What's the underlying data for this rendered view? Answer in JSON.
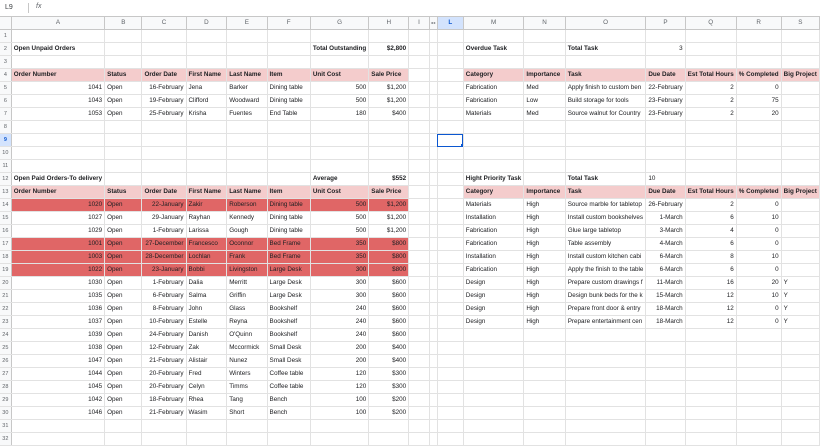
{
  "formula_bar": {
    "cell_ref": "L9",
    "fx": "fx"
  },
  "grid": {
    "columns": [
      "A",
      "B",
      "C",
      "D",
      "E",
      "F",
      "G",
      "H",
      "I",
      "◂ ▸",
      "L",
      "M",
      "N",
      "O",
      "P",
      "Q",
      "R",
      "S"
    ],
    "row_numbers": [
      "1",
      "2",
      "3",
      "4",
      "5",
      "6",
      "7",
      "8",
      "9",
      "10",
      "11",
      "12",
      "13",
      "14",
      "15",
      "16",
      "17",
      "18",
      "19",
      "20",
      "21",
      "22",
      "23",
      "24",
      "25",
      "26",
      "27",
      "28",
      "29",
      "30",
      "31",
      "32"
    ],
    "selected_cell": "L9",
    "colors": {
      "header_pink": "#f4cccc",
      "highlight_red": "#e06666",
      "selection_blue": "#0b57d0"
    }
  },
  "left": {
    "unpaid_title": "Open Unpaid Orders",
    "total_outstanding_label": "Total Outstanding",
    "total_outstanding_value": "$2,800",
    "headers": [
      "Order Number",
      "Status",
      "Order Date",
      "First Name",
      "Last Name",
      "Item",
      "Unit Cost",
      "Sale Price"
    ],
    "unpaid_rows": [
      [
        "1041",
        "Open",
        "16-February",
        "Jena",
        "Barker",
        "Dining table",
        "500",
        "$1,200"
      ],
      [
        "1043",
        "Open",
        "19-February",
        "Clifford",
        "Woodward",
        "Dining table",
        "500",
        "$1,200"
      ],
      [
        "1053",
        "Open",
        "25-February",
        "Krisha",
        "Fuentes",
        "End Table",
        "180",
        "$400"
      ]
    ],
    "paid_title": "Open Paid Orders-To delivery",
    "average_label": "Average",
    "average_value": "$552",
    "paid_rows": [
      [
        "1020",
        "Open",
        "22-January",
        "Zakir",
        "Roberson",
        "Dining table",
        "500",
        "$1,200"
      ],
      [
        "1027",
        "Open",
        "29-January",
        "Rayhan",
        "Kennedy",
        "Dining table",
        "500",
        "$1,200"
      ],
      [
        "1029",
        "Open",
        "1-February",
        "Larissa",
        "Gough",
        "Dining table",
        "500",
        "$1,200"
      ],
      [
        "1001",
        "Open",
        "27-December",
        "Francesco",
        "Oconnor",
        "Bed Frame",
        "350",
        "$800"
      ],
      [
        "1003",
        "Open",
        "28-December",
        "Lochlan",
        "Frank",
        "Bed Frame",
        "350",
        "$800"
      ],
      [
        "1022",
        "Open",
        "23-January",
        "Bobbi",
        "Livingston",
        "Large Desk",
        "300",
        "$800"
      ],
      [
        "1030",
        "Open",
        "1-February",
        "Dalia",
        "Merritt",
        "Large Desk",
        "300",
        "$600"
      ],
      [
        "1035",
        "Open",
        "6-February",
        "Salma",
        "Griffin",
        "Large Desk",
        "300",
        "$600"
      ],
      [
        "1036",
        "Open",
        "8-February",
        "John",
        "Glass",
        "Bookshelf",
        "240",
        "$600"
      ],
      [
        "1037",
        "Open",
        "10-February",
        "Estelle",
        "Reyna",
        "Bookshelf",
        "240",
        "$600"
      ],
      [
        "1039",
        "Open",
        "24-February",
        "Danish",
        "O'Quinn",
        "Bookshelf",
        "240",
        "$600"
      ],
      [
        "1038",
        "Open",
        "12-February",
        "Zak",
        "Mccormick",
        "Small Desk",
        "200",
        "$400"
      ],
      [
        "1047",
        "Open",
        "21-February",
        "Alistair",
        "Nunez",
        "Small Desk",
        "200",
        "$400"
      ],
      [
        "1044",
        "Open",
        "20-February",
        "Fred",
        "Winters",
        "Coffee table",
        "120",
        "$300"
      ],
      [
        "1045",
        "Open",
        "20-February",
        "Celyn",
        "Timms",
        "Coffee table",
        "120",
        "$300"
      ],
      [
        "1042",
        "Open",
        "18-February",
        "Rhea",
        "Tang",
        "Bench",
        "100",
        "$200"
      ],
      [
        "1046",
        "Open",
        "21-February",
        "Wasim",
        "Short",
        "Bench",
        "100",
        "$200"
      ]
    ],
    "paid_red_rows": [
      0,
      3,
      4,
      5
    ]
  },
  "right": {
    "overdue_title": "Overdue Task",
    "total_task_label": "Total Task",
    "overdue_total": "3",
    "headers": [
      "Category",
      "Importance",
      "Task",
      "Due Date",
      "Est Total Hours",
      "% Completed",
      "Big Project"
    ],
    "overdue_rows": [
      [
        "Fabrication",
        "Med",
        "Apply finish to custom ben",
        "22-February",
        "2",
        "0",
        ""
      ],
      [
        "Fabrication",
        "Low",
        "Build storage for tools",
        "23-February",
        "2",
        "75",
        ""
      ],
      [
        "Materials",
        "Med",
        "Source walnut for Country",
        "23-February",
        "2",
        "20",
        ""
      ]
    ],
    "high_title": "Hight Priority Task",
    "high_total": "10",
    "high_rows": [
      [
        "Materials",
        "High",
        "Source marble for tabletop",
        "26-February",
        "2",
        "0",
        ""
      ],
      [
        "Installation",
        "High",
        "Install custom bookshelves",
        "1-March",
        "6",
        "10",
        ""
      ],
      [
        "Fabrication",
        "High",
        "Glue large tabletop",
        "3-March",
        "4",
        "0",
        ""
      ],
      [
        "Fabrication",
        "High",
        "Table assembly",
        "4-March",
        "6",
        "0",
        ""
      ],
      [
        "Installation",
        "High",
        "Install custom kitchen cabi",
        "6-March",
        "8",
        "10",
        ""
      ],
      [
        "Fabrication",
        "High",
        "Apply the finish to the table",
        "6-March",
        "6",
        "0",
        ""
      ],
      [
        "Design",
        "High",
        "Prepare custom drawings f",
        "11-March",
        "16",
        "20",
        "Y"
      ],
      [
        "Design",
        "High",
        "Design bunk beds for the k",
        "15-March",
        "12",
        "10",
        "Y"
      ],
      [
        "Design",
        "High",
        "Prepare front door & entry",
        "18-March",
        "12",
        "0",
        "Y"
      ],
      [
        "Design",
        "High",
        "Prepare entertainment cen",
        "18-March",
        "12",
        "0",
        "Y"
      ]
    ]
  }
}
